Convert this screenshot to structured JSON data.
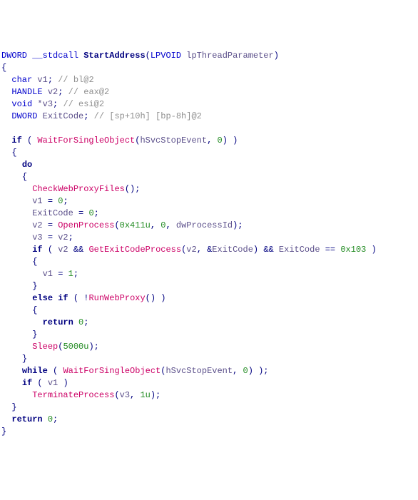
{
  "sig": {
    "ret": "DWORD",
    "call": "__stdcall",
    "name": "StartAddress",
    "ptype": "LPVOID",
    "pname": "lpThreadParameter"
  },
  "decl": {
    "v1": {
      "type": "char",
      "name": "v1",
      "cmt": "// bl@2"
    },
    "v2": {
      "type": "HANDLE",
      "name": "v2",
      "cmt": "// eax@2"
    },
    "v3": {
      "type": "void",
      "name": "*v3",
      "cmt": "// esi@2"
    },
    "ec": {
      "type": "DWORD",
      "name": "ExitCode",
      "cmt": "// [sp+10h] [bp-8h]@2"
    }
  },
  "fn": {
    "wfso": "WaitForSingleObject",
    "cwp": "CheckWebProxyFiles",
    "op": "OpenProcess",
    "gecp": "GetExitCodeProcess",
    "rwp": "RunWebProxy",
    "sleep": "Sleep",
    "tp": "TerminateProcess"
  },
  "gvar": {
    "hstop": "hSvcStopEvent",
    "dwpid": "dwProcessId"
  },
  "lvar": {
    "v1": "v1",
    "v2": "v2",
    "v3": "v3",
    "ec": "ExitCode"
  },
  "num": {
    "zero": "0",
    "h411": "0x411u",
    "h103": "0x103",
    "k5": "5000u",
    "one": "1",
    "one_u": "1u"
  },
  "kw": {
    "if": "if",
    "do": "do",
    "while": "while",
    "elseif": "else if",
    "return": "return"
  }
}
